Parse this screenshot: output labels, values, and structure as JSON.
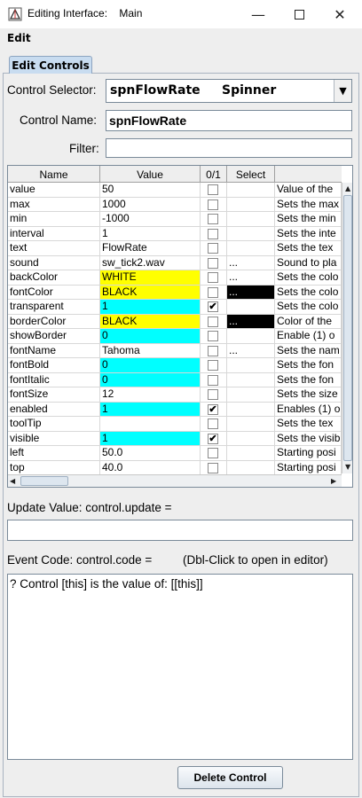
{
  "window": {
    "title": "Editing Interface:    Main",
    "minimize_icon": "minimize-icon",
    "maximize_icon": "maximize-icon",
    "close_icon": "close-icon"
  },
  "menu": {
    "edit": "Edit"
  },
  "tab": {
    "label": "Edit Controls"
  },
  "selector": {
    "label": "Control Selector:",
    "name": "spnFlowRate",
    "type": "Spinner"
  },
  "control_name": {
    "label": "Control Name:",
    "value": "spnFlowRate"
  },
  "filter": {
    "label": "Filter:",
    "value": ""
  },
  "table": {
    "headers": [
      "Name",
      "Value",
      "0/1",
      "Select",
      ""
    ],
    "rows": [
      {
        "name": "value",
        "value": "50",
        "checked": false,
        "select": "",
        "desc": "Value of the",
        "color": ""
      },
      {
        "name": "max",
        "value": "1000",
        "checked": false,
        "select": "",
        "desc": "Sets the max",
        "color": ""
      },
      {
        "name": "min",
        "value": "-1000",
        "checked": false,
        "select": "",
        "desc": "Sets the min",
        "color": ""
      },
      {
        "name": "interval",
        "value": "1",
        "checked": false,
        "select": "",
        "desc": "Sets the inte",
        "color": ""
      },
      {
        "name": "text",
        "value": "FlowRate",
        "checked": false,
        "select": "",
        "desc": "Sets the tex",
        "color": ""
      },
      {
        "name": "sound",
        "value": "sw_tick2.wav",
        "checked": false,
        "select": "...",
        "desc": "Sound to pla",
        "color": ""
      },
      {
        "name": "backColor",
        "value": "WHITE",
        "checked": false,
        "select": "...",
        "desc": "Sets the colo",
        "color": "#ffff00",
        "swatch": ""
      },
      {
        "name": "fontColor",
        "value": "BLACK",
        "checked": false,
        "select": "...",
        "desc": "Sets the colo",
        "color": "#ffff00",
        "swatch": "#000000"
      },
      {
        "name": "transparent",
        "value": "1",
        "checked": true,
        "select": "",
        "desc": "Sets the colo",
        "color": "#00ffff"
      },
      {
        "name": "borderColor",
        "value": "BLACK",
        "checked": false,
        "select": "...",
        "desc": "Color of the",
        "color": "#ffff00",
        "swatch": "#000000"
      },
      {
        "name": "showBorder",
        "value": "0",
        "checked": false,
        "select": "",
        "desc": "Enable (1) o",
        "color": "#00ffff"
      },
      {
        "name": "fontName",
        "value": "Tahoma",
        "checked": false,
        "select": "...",
        "desc": "Sets the nam",
        "color": ""
      },
      {
        "name": "fontBold",
        "value": "0",
        "checked": false,
        "select": "",
        "desc": "Sets the fon",
        "color": "#00ffff"
      },
      {
        "name": "fontItalic",
        "value": "0",
        "checked": false,
        "select": "",
        "desc": "Sets the fon",
        "color": "#00ffff"
      },
      {
        "name": "fontSize",
        "value": "12",
        "checked": false,
        "select": "",
        "desc": "Sets the size",
        "color": ""
      },
      {
        "name": "enabled",
        "value": "1",
        "checked": true,
        "select": "",
        "desc": "Enables (1) o",
        "color": "#00ffff"
      },
      {
        "name": "toolTip",
        "value": "",
        "checked": false,
        "select": "",
        "desc": "Sets the tex",
        "color": ""
      },
      {
        "name": "visible",
        "value": "1",
        "checked": true,
        "select": "",
        "desc": "Sets the visib",
        "color": "#00ffff"
      },
      {
        "name": "left",
        "value": "50.0",
        "checked": false,
        "select": "",
        "desc": "Starting posi",
        "color": ""
      },
      {
        "name": "top",
        "value": "40.0",
        "checked": false,
        "select": "",
        "desc": "Starting posi",
        "color": ""
      }
    ]
  },
  "update": {
    "label": "Update Value: control.update =",
    "value": ""
  },
  "event": {
    "label": "Event Code: control.code =",
    "hint": "(Dbl-Click to open in editor)",
    "code": "? Control [this] is the value of: [[this]]"
  },
  "delete_button": "Delete Control"
}
